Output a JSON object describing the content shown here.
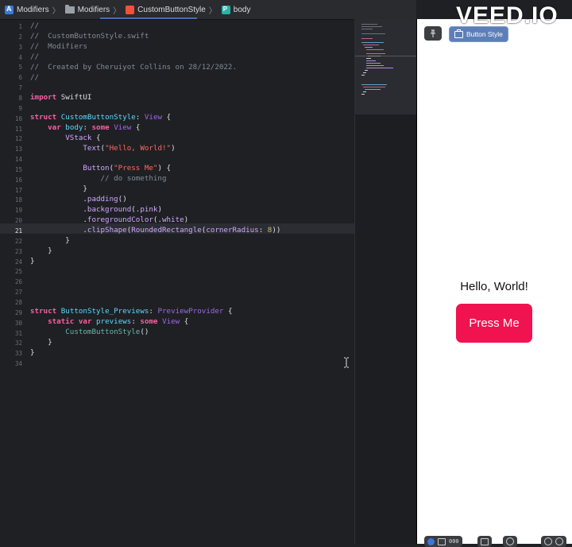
{
  "breadcrumb": [
    {
      "label": "Modifiers",
      "icon": "app-icon"
    },
    {
      "label": "Modifiers",
      "icon": "folder-icon"
    },
    {
      "label": "CustomButtonStyle",
      "icon": "swift-file-icon"
    },
    {
      "label": "body",
      "icon": "property-icon"
    }
  ],
  "editor": {
    "current_line": 21,
    "line_numbers": [
      "1",
      "2",
      "3",
      "4",
      "5",
      "6",
      "7",
      "8",
      "9",
      "10",
      "11",
      "12",
      "13",
      "14",
      "15",
      "16",
      "17",
      "18",
      "19",
      "20",
      "21",
      "22",
      "23",
      "24",
      "25",
      "26",
      "27",
      "28",
      "29",
      "30",
      "31",
      "32",
      "33",
      "34"
    ]
  },
  "canvas": {
    "preview_chip_label": "Button Style",
    "hello_text": "Hello, World!",
    "button_label": "Press Me",
    "bottom_readout": "000"
  },
  "watermark": "VEED.IO",
  "colors": {
    "accent_pink": "#f0134f",
    "keyword": "#fc5fa3",
    "type": "#5dd8ff",
    "comment": "#7f8c98",
    "string": "#fc6a5d",
    "number": "#d0bf69",
    "chip_blue": "#5d7fb8"
  }
}
